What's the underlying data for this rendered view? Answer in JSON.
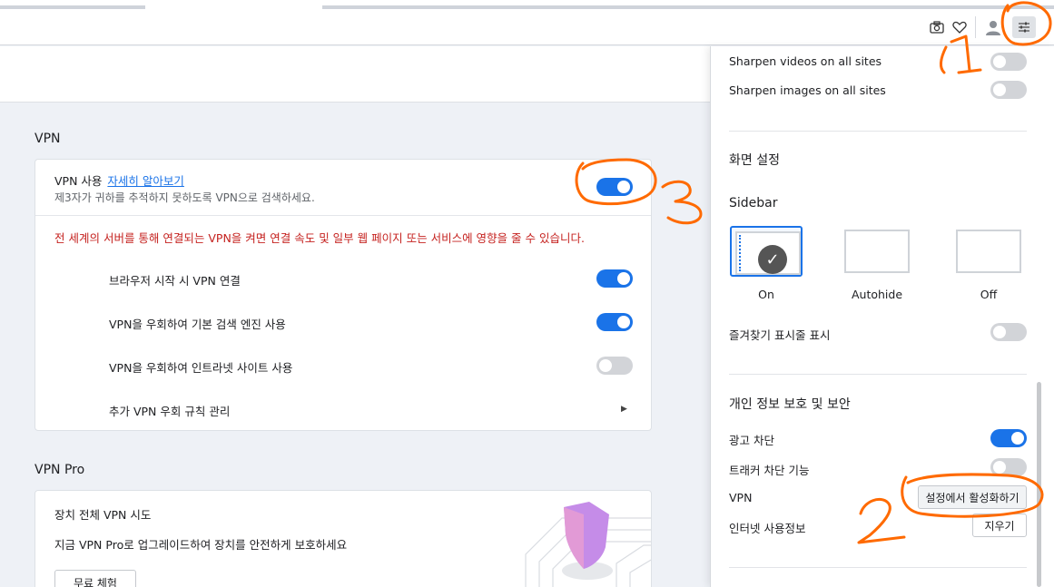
{
  "colors": {
    "accent": "#1a73e8",
    "warning": "#c5221f",
    "annotation": "#ff6a00"
  },
  "toolbar": {
    "icons": [
      "camera-icon",
      "heart-icon",
      "profile-icon",
      "easy-setup-icon"
    ]
  },
  "vpn": {
    "section_title": "VPN",
    "use_label": "VPN 사용",
    "learn_more": "자세히 알아보기",
    "description": "제3자가 귀하를 추적하지 못하도록 VPN으로 검색하세요.",
    "enabled": true,
    "warning": "전 세계의 서버를 통해 연결되는 VPN을 켜면 연결 속도 및 일부 웹 페이지 또는 서비스에 영향을 줄 수 있습니다.",
    "options": [
      {
        "label": "브라우저 시작 시 VPN 연결",
        "on": true
      },
      {
        "label": "VPN을 우회하여 기본 검색 엔진 사용",
        "on": true
      },
      {
        "label": "VPN을 우회하여 인트라넷 사이트 사용",
        "on": false
      }
    ],
    "rules_label": "추가 VPN 우회 규칙 관리"
  },
  "vpn_pro": {
    "section_title": "VPN Pro",
    "title": "장치 전체 VPN 시도",
    "description": "지금 VPN Pro로 업그레이드하여 장치를 안전하게 보호하세요",
    "trial_button": "무료 체험"
  },
  "panel": {
    "sharpen_videos": {
      "label": "Sharpen videos on all sites",
      "on": false
    },
    "sharpen_images": {
      "label": "Sharpen images on all sites",
      "on": false
    },
    "display_heading": "화면 설정",
    "sidebar_heading": "Sidebar",
    "sidebar_options": [
      {
        "label": "On",
        "selected": true
      },
      {
        "label": "Autohide",
        "selected": false
      },
      {
        "label": "Off",
        "selected": false
      }
    ],
    "bookmarks_bar": {
      "label": "즐겨찾기 표시줄 표시",
      "on": false
    },
    "privacy_heading": "개인 정보 보호 및 보안",
    "ad_block": {
      "label": "광고 차단",
      "on": true
    },
    "tracker_block": {
      "label": "트래커 차단 기능",
      "on": false
    },
    "vpn_label": "VPN",
    "vpn_button": "설정에서 활성화하기",
    "browsing_data_label": "인터넷 사용정보",
    "clear_button": "지우기"
  },
  "annotations": [
    "1",
    "2",
    "3"
  ]
}
